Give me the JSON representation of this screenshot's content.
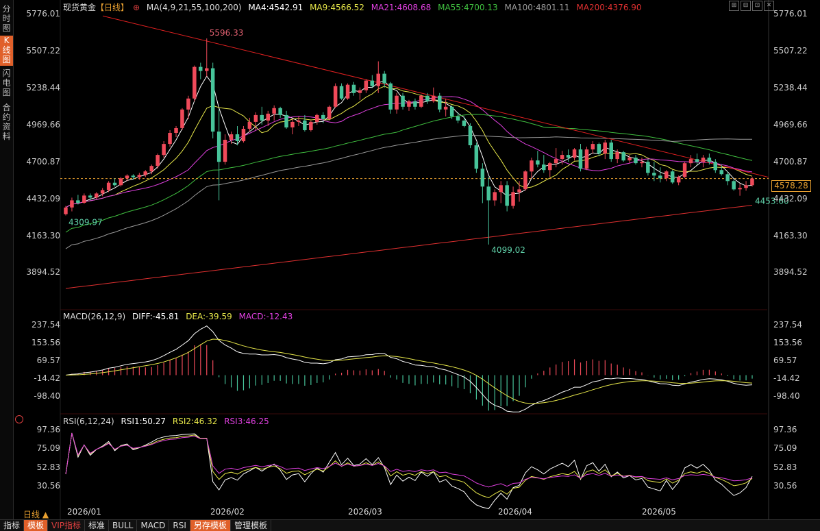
{
  "left_tabs": [
    "分时图",
    "K线图",
    "闪电图",
    "合约资料"
  ],
  "legend": {
    "symbol": "现货黄金",
    "period_tag": "【日线】",
    "plus": "⊕",
    "ma_params": "MA(4,9,21,55,100,200)",
    "ma4": "MA4:4542.91",
    "ma9": "MA9:4566.52",
    "ma21": "MA21:4608.68",
    "ma55": "MA55:4700.13",
    "ma100": "MA100:4801.11",
    "ma200": "MA200:4376.90"
  },
  "macd_legend": {
    "name": "MACD(26,12,9)",
    "diff": "DIFF:-45.81",
    "dea": "DEA:-39.59",
    "macd": "MACD:-12.43"
  },
  "rsi_legend": {
    "name": "RSI(6,12,24)",
    "rsi1": "RSI1:50.27",
    "rsi2": "RSI2:46.32",
    "rsi3": "RSI3:46.25"
  },
  "price_axis": [
    "5776.01",
    "5507.22",
    "5238.44",
    "4969.66",
    "4700.87",
    "4432.09",
    "4163.30",
    "3894.52"
  ],
  "macd_axis": [
    "237.54",
    "153.56",
    "69.57",
    "-14.42",
    "-98.40"
  ],
  "rsi_axis": [
    "97.36",
    "75.09",
    "52.83",
    "30.56"
  ],
  "current_price": "4578.28",
  "annotations": {
    "high": "5596.33",
    "low": "4099.02",
    "start_low": "4309.97",
    "recent_low": "4453.60"
  },
  "dates": [
    "2026/01",
    "2026/02",
    "2026/03",
    "2026/04",
    "2026/05"
  ],
  "period_label": "日线 ▲",
  "bottom_buttons": [
    "指标",
    "模板",
    "VIP指标",
    "标准",
    "BULL",
    "MACD",
    "RSI",
    "另存模板",
    "管理模板"
  ],
  "top_icons": [
    "⊞",
    "⊟",
    "⊡",
    "✕"
  ],
  "colors": {
    "up": "#f04a5a",
    "down": "#47c49a",
    "ma4": "#ffffff",
    "ma9": "#e8e84a",
    "ma21": "#e040e0",
    "ma55": "#40c040",
    "ma100": "#9a9a9a",
    "ma200": "#e03030",
    "trend": "#e02020",
    "current": "#e8a030"
  },
  "chart_data": {
    "type": "candlestick",
    "title": "现货黄金【日线】",
    "ylim": [
      3894.52,
      5776.01
    ],
    "price_ticks": [
      5776.01,
      5507.22,
      5238.44,
      4969.66,
      4700.87,
      4432.09,
      4163.3,
      3894.52
    ],
    "x_labels": [
      "2026/01",
      "2026/02",
      "2026/03",
      "2026/04",
      "2026/05"
    ],
    "candles": [
      [
        4320,
        4380,
        4309.97,
        4368
      ],
      [
        4368,
        4440,
        4340,
        4420
      ],
      [
        4420,
        4460,
        4390,
        4402
      ],
      [
        4402,
        4470,
        4395,
        4455
      ],
      [
        4455,
        4470,
        4420,
        4440
      ],
      [
        4440,
        4480,
        4430,
        4470
      ],
      [
        4470,
        4510,
        4450,
        4495
      ],
      [
        4495,
        4560,
        4480,
        4548
      ],
      [
        4548,
        4580,
        4520,
        4530
      ],
      [
        4530,
        4590,
        4520,
        4580
      ],
      [
        4580,
        4610,
        4560,
        4600
      ],
      [
        4600,
        4610,
        4570,
        4588
      ],
      [
        4588,
        4620,
        4570,
        4605
      ],
      [
        4605,
        4640,
        4590,
        4630
      ],
      [
        4630,
        4680,
        4610,
        4670
      ],
      [
        4670,
        4760,
        4650,
        4750
      ],
      [
        4750,
        4850,
        4730,
        4830
      ],
      [
        4830,
        4930,
        4810,
        4910
      ],
      [
        4910,
        4960,
        4880,
        4945
      ],
      [
        4945,
        5090,
        4930,
        5080
      ],
      [
        5080,
        5180,
        5010,
        5160
      ],
      [
        5160,
        5400,
        5140,
        5390
      ],
      [
        5390,
        5420,
        5300,
        5360
      ],
      [
        5360,
        5596.33,
        5320,
        5380
      ],
      [
        5380,
        5420,
        4870,
        4920
      ],
      [
        4920,
        5080,
        4420,
        4700
      ],
      [
        4700,
        4900,
        4680,
        4860
      ],
      [
        4860,
        4920,
        4830,
        4900
      ],
      [
        4900,
        4960,
        4820,
        4850
      ],
      [
        4850,
        4960,
        4840,
        4940
      ],
      [
        4940,
        5020,
        4920,
        4990
      ],
      [
        4990,
        5060,
        4930,
        5040
      ],
      [
        5040,
        5100,
        4970,
        5000
      ],
      [
        5000,
        5070,
        4960,
        5050
      ],
      [
        5050,
        5110,
        5000,
        5090
      ],
      [
        5090,
        5100,
        5020,
        5040
      ],
      [
        5040,
        5070,
        4940,
        4950
      ],
      [
        4950,
        5010,
        4900,
        4990
      ],
      [
        4990,
        5030,
        4960,
        5000
      ],
      [
        5000,
        5040,
        4920,
        4930
      ],
      [
        4930,
        5000,
        4920,
        4990
      ],
      [
        4990,
        5050,
        4970,
        5040
      ],
      [
        5040,
        5060,
        4980,
        5010
      ],
      [
        5010,
        5110,
        5000,
        5100
      ],
      [
        5100,
        5270,
        5090,
        5250
      ],
      [
        5250,
        5270,
        5150,
        5160
      ],
      [
        5160,
        5270,
        5150,
        5260
      ],
      [
        5260,
        5280,
        5180,
        5200
      ],
      [
        5200,
        5240,
        5150,
        5220
      ],
      [
        5220,
        5300,
        5200,
        5290
      ],
      [
        5290,
        5330,
        5240,
        5250
      ],
      [
        5250,
        5430,
        5200,
        5340
      ],
      [
        5340,
        5360,
        5240,
        5270
      ],
      [
        5270,
        5280,
        5050,
        5080
      ],
      [
        5080,
        5200,
        5050,
        5180
      ],
      [
        5180,
        5200,
        5080,
        5100
      ],
      [
        5100,
        5150,
        5070,
        5140
      ],
      [
        5140,
        5160,
        5080,
        5100
      ],
      [
        5100,
        5190,
        5090,
        5180
      ],
      [
        5180,
        5200,
        5120,
        5140
      ],
      [
        5140,
        5240,
        5130,
        5180
      ],
      [
        5180,
        5200,
        5060,
        5080
      ],
      [
        5080,
        5160,
        5030,
        5100
      ],
      [
        5100,
        5110,
        5010,
        5030
      ],
      [
        5030,
        5060,
        4980,
        5000
      ],
      [
        5000,
        5030,
        4950,
        4960
      ],
      [
        4960,
        4980,
        4800,
        4820
      ],
      [
        4820,
        4840,
        4620,
        4650
      ],
      [
        4650,
        4690,
        4400,
        4520
      ],
      [
        4520,
        4590,
        4099.02,
        4420
      ],
      [
        4420,
        4500,
        4380,
        4480
      ],
      [
        4480,
        4560,
        4400,
        4530
      ],
      [
        4530,
        4560,
        4340,
        4380
      ],
      [
        4380,
        4520,
        4360,
        4480
      ],
      [
        4480,
        4560,
        4410,
        4500
      ],
      [
        4500,
        4640,
        4490,
        4630
      ],
      [
        4630,
        4730,
        4580,
        4710
      ],
      [
        4710,
        4780,
        4660,
        4680
      ],
      [
        4680,
        4750,
        4620,
        4640
      ],
      [
        4640,
        4700,
        4590,
        4690
      ],
      [
        4690,
        4800,
        4660,
        4720
      ],
      [
        4720,
        4780,
        4680,
        4750
      ],
      [
        4750,
        4790,
        4700,
        4730
      ],
      [
        4730,
        4800,
        4710,
        4790
      ],
      [
        4790,
        4830,
        4630,
        4650
      ],
      [
        4650,
        4810,
        4640,
        4790
      ],
      [
        4790,
        4850,
        4760,
        4830
      ],
      [
        4830,
        4840,
        4740,
        4760
      ],
      [
        4760,
        4860,
        4720,
        4840
      ],
      [
        4840,
        4860,
        4700,
        4720
      ],
      [
        4720,
        4790,
        4690,
        4770
      ],
      [
        4770,
        4780,
        4700,
        4710
      ],
      [
        4710,
        4750,
        4690,
        4730
      ],
      [
        4730,
        4750,
        4680,
        4690
      ],
      [
        4690,
        4730,
        4660,
        4700
      ],
      [
        4700,
        4720,
        4600,
        4620
      ],
      [
        4620,
        4700,
        4560,
        4600
      ],
      [
        4600,
        4660,
        4550,
        4580
      ],
      [
        4580,
        4640,
        4560,
        4630
      ],
      [
        4630,
        4640,
        4540,
        4550
      ],
      [
        4550,
        4600,
        4530,
        4590
      ],
      [
        4590,
        4700,
        4580,
        4690
      ],
      [
        4690,
        4750,
        4660,
        4720
      ],
      [
        4720,
        4760,
        4680,
        4700
      ],
      [
        4700,
        4750,
        4660,
        4730
      ],
      [
        4730,
        4760,
        4680,
        4700
      ],
      [
        4700,
        4720,
        4620,
        4640
      ],
      [
        4640,
        4680,
        4600,
        4610
      ],
      [
        4610,
        4630,
        4530,
        4560
      ],
      [
        4560,
        4570,
        4490,
        4500
      ],
      [
        4500,
        4540,
        4453.6,
        4510
      ],
      [
        4510,
        4560,
        4490,
        4530
      ],
      [
        4530,
        4590,
        4520,
        4578.28
      ]
    ],
    "macd": {
      "ylim": [
        -130,
        250
      ],
      "ticks": [
        237.54,
        153.56,
        69.57,
        -14.42,
        -98.4
      ],
      "diff_last": -45.81,
      "dea_last": -39.59,
      "macd_last": -12.43
    },
    "rsi": {
      "ylim": [
        10,
        105
      ],
      "ticks": [
        97.36,
        75.09,
        52.83,
        30.56
      ],
      "rsi1_last": 50.27,
      "rsi2_last": 46.32,
      "rsi3_last": 46.25
    }
  }
}
